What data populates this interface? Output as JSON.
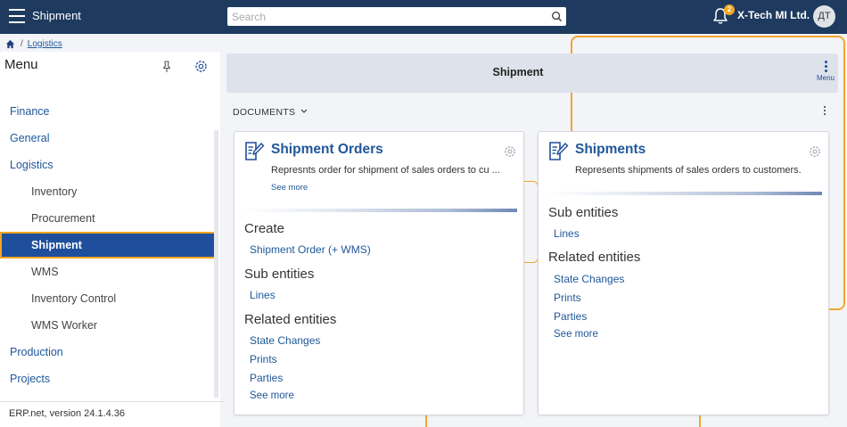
{
  "topbar": {
    "app_title": "Shipment",
    "search_placeholder": "Search",
    "notification_count": "2",
    "company": "X-Tech MI Ltd.",
    "avatar_initials": "ДТ"
  },
  "breadcrumb": {
    "separator": "/",
    "current": "Logistics"
  },
  "sidebar": {
    "title": "Menu",
    "items": [
      {
        "label": "Finance"
      },
      {
        "label": "General"
      },
      {
        "label": "Logistics"
      },
      {
        "label": "Inventory"
      },
      {
        "label": "Procurement"
      },
      {
        "label": "Shipment"
      },
      {
        "label": "WMS"
      },
      {
        "label": "Inventory Control"
      },
      {
        "label": "WMS Worker"
      },
      {
        "label": "Production"
      },
      {
        "label": "Projects"
      }
    ],
    "version": "ERP.net, version 24.1.4.36"
  },
  "main": {
    "title": "Shipment",
    "menu_label": "Menu",
    "section_label": "DOCUMENTS"
  },
  "cards": [
    {
      "title": "Shipment Orders",
      "description": "Represnts order for shipment of sales orders to cu ...",
      "see_more_top": "See more",
      "create_heading": "Create",
      "create_links": [
        "Shipment Order (+ WMS)"
      ],
      "sub_heading": "Sub entities",
      "sub_links": [
        "Lines"
      ],
      "related_heading": "Related entities",
      "related_links": [
        "State Changes",
        "Prints",
        "Parties"
      ],
      "see_more": "See more"
    },
    {
      "title": "Shipments",
      "description": "Represents shipments of sales orders to customers.",
      "sub_heading": "Sub entities",
      "sub_links": [
        "Lines"
      ],
      "related_heading": "Related entities",
      "related_links": [
        "State Changes",
        "Prints",
        "Parties"
      ],
      "see_more": "See more"
    }
  ],
  "colors": {
    "topbar": "#1e3a5f",
    "accent": "#1f4f9c",
    "highlight": "#f5a623"
  }
}
